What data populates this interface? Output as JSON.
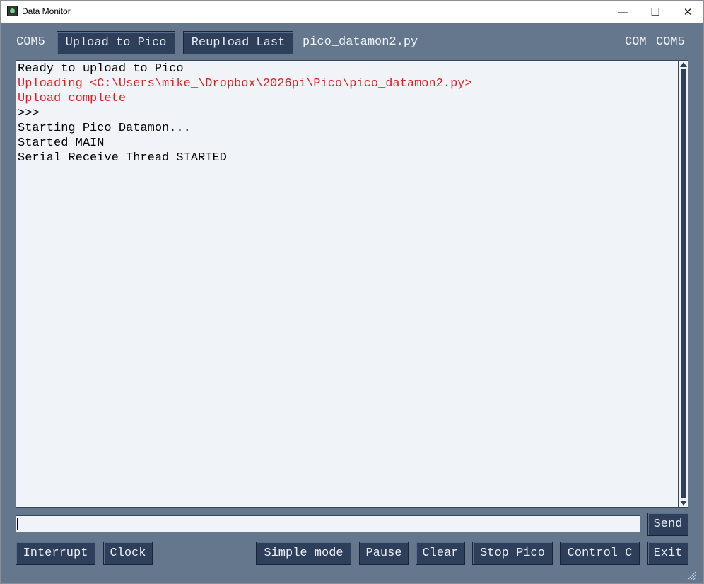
{
  "window": {
    "title": "Data Monitor",
    "icon": "app-icon"
  },
  "titlebar": {
    "minimize_glyph": "—",
    "maximize_glyph": "☐",
    "close_glyph": "✕"
  },
  "toolbar": {
    "port_label": "COM5",
    "upload_label": "Upload to Pico",
    "reupload_label": "Reupload Last",
    "filename": "pico_datamon2.py",
    "com_label": "COM",
    "com_value": "COM5"
  },
  "console": {
    "lines": [
      {
        "text": "Ready to upload to Pico",
        "color": "#000000"
      },
      {
        "text": "Uploading <C:\\Users\\mike_\\Dropbox\\2026pi\\Pico\\pico_datamon2.py>",
        "color": "#e02020"
      },
      {
        "text": "Upload complete",
        "color": "#e02020"
      },
      {
        "text": ">>>",
        "color": "#000000"
      },
      {
        "text": "Starting Pico Datamon...",
        "color": "#000000"
      },
      {
        "text": "Started MAIN",
        "color": "#000000"
      },
      {
        "text": "Serial Receive Thread STARTED",
        "color": "#000000"
      }
    ]
  },
  "input": {
    "value": "",
    "send_label": "Send"
  },
  "bottom": {
    "interrupt_label": "Interrupt",
    "clock_label": "Clock",
    "simple_mode_label": "Simple mode",
    "pause_label": "Pause",
    "clear_label": "Clear",
    "stop_pico_label": "Stop Pico",
    "control_c_label": "Control C",
    "exit_label": "Exit"
  },
  "colors": {
    "background": "#64778d",
    "button": "#2e3f5c",
    "console_bg": "#f0f3f8",
    "error_text": "#e02020"
  }
}
